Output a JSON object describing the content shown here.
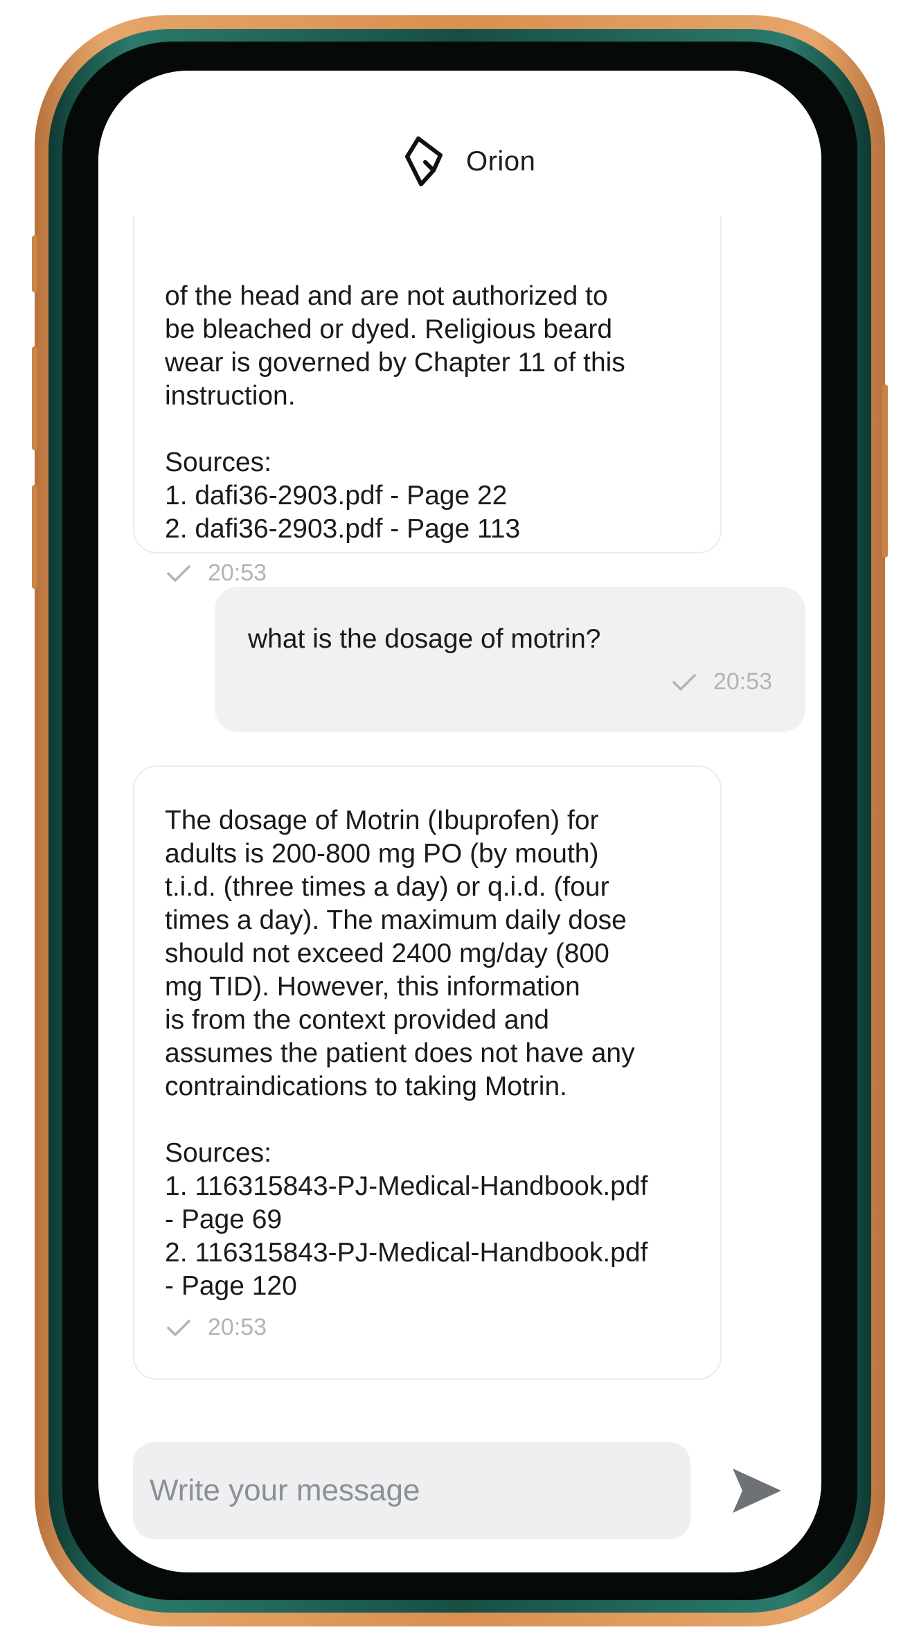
{
  "app": {
    "title": "Orion",
    "logo_icon": "orion-logo-icon"
  },
  "messages": [
    {
      "role": "assistant",
      "text": "of the head and are not authorized to\nbe bleached or dyed. Religious beard\nwear is governed by Chapter 11 of this\ninstruction.\n\nSources:\n1. dafi36-2903.pdf - Page 22\n2. dafi36-2903.pdf - Page 113",
      "time": "20:53",
      "status_icon": "check-icon"
    },
    {
      "role": "user",
      "text": "what is the dosage of motrin?",
      "time": "20:53",
      "status_icon": "check-icon"
    },
    {
      "role": "assistant",
      "text": "The dosage of Motrin (Ibuprofen) for\nadults is 200-800 mg PO (by mouth)\nt.i.d. (three times a day) or q.i.d. (four\ntimes a day). The maximum daily dose\nshould not exceed 2400 mg/day (800\nmg TID). However, this information\nis from the context provided and\nassumes the patient does not have any\ncontraindications to taking Motrin.\n\nSources:\n1. 116315843-PJ-Medical-Handbook.pdf\n- Page 69\n2. 116315843-PJ-Medical-Handbook.pdf\n- Page 120",
      "time": "20:53",
      "status_icon": "check-icon"
    }
  ],
  "composer": {
    "placeholder": "Write your message",
    "value": "",
    "send_icon": "send-icon"
  },
  "colors": {
    "frame_gold": "#d99050",
    "frame_green": "#174e44",
    "user_bubble": "#f0f1f2",
    "timestamp": "#b3b3b3"
  }
}
